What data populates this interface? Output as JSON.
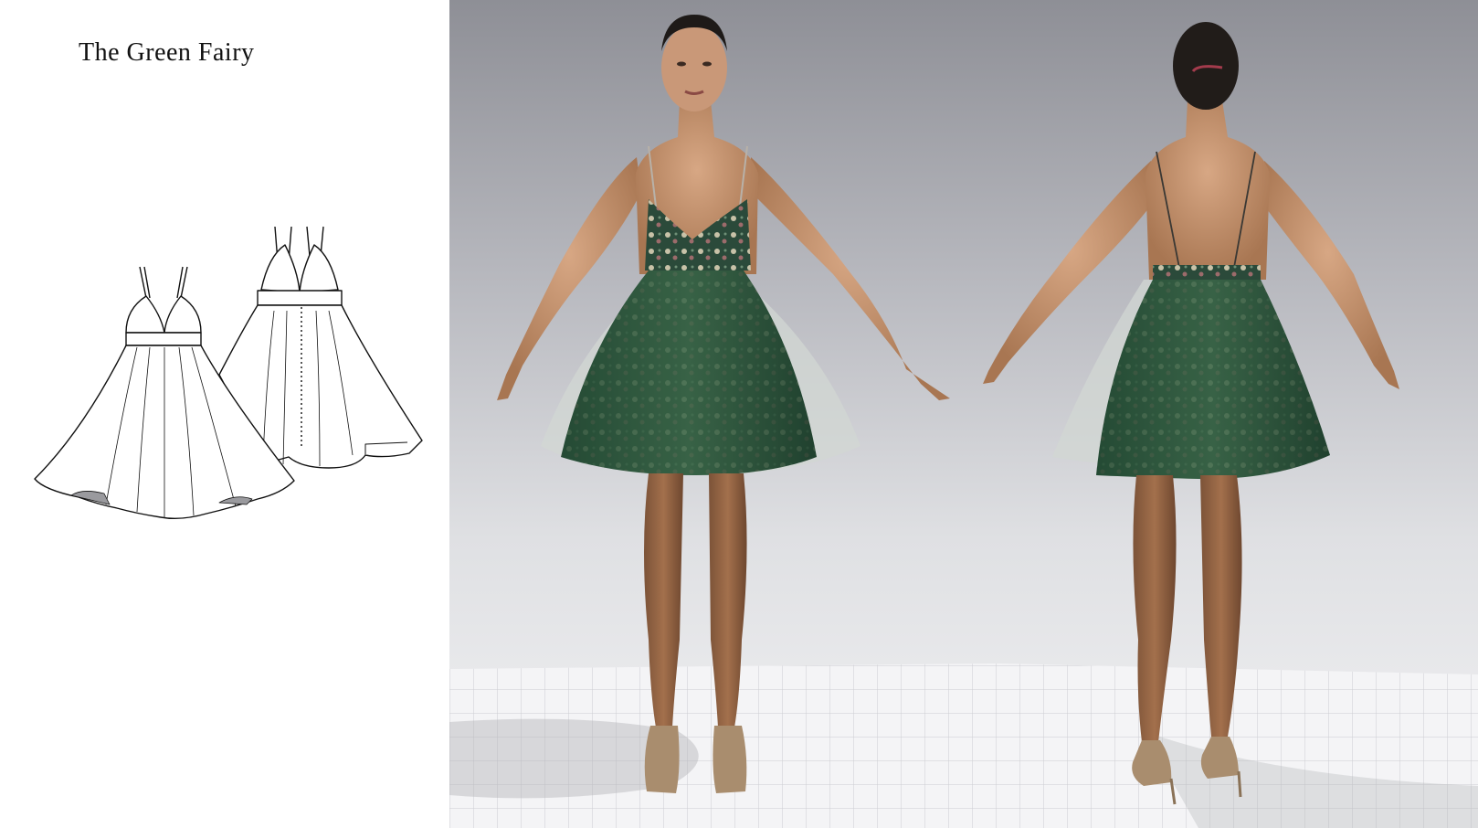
{
  "title": "The Green Fairy",
  "illustration": {
    "flat_front": "technical-flat-front",
    "flat_back": "technical-flat-back",
    "avatar_front": "avatar-front-view",
    "avatar_back": "avatar-back-view"
  },
  "colors": {
    "background": "#ffffff",
    "viewport_top": "#8e8f96",
    "viewport_bottom": "#f2f2f4",
    "dress_green": "#2f5a40",
    "dress_dark": "#1f3f2d",
    "skin": "#c89674",
    "tulle": "#c9cfcb",
    "shoes": "#a98d6e",
    "hair": "#1e1a18"
  }
}
